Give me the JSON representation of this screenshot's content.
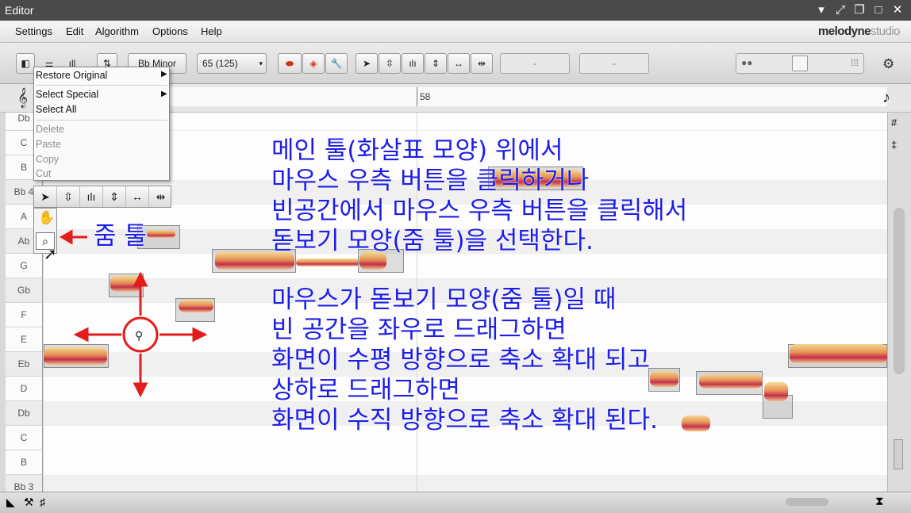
{
  "window": {
    "title": "Editor"
  },
  "menu": {
    "items": [
      "Settings",
      "Edit",
      "Algorithm",
      "Options",
      "Help"
    ],
    "brand": "melodyne",
    "brand_suffix": "studio"
  },
  "toolbar": {
    "scale": "Bb Minor",
    "tempo": "65 (125)",
    "field_a": "-",
    "field_b": "-"
  },
  "ruler": {
    "bar": "58"
  },
  "keys": [
    "Db",
    "C",
    "B",
    "Bb 4",
    "A",
    "Ab",
    "G",
    "Gb",
    "F",
    "E",
    "Eb",
    "D",
    "Db",
    "C",
    "B",
    "Bb 3"
  ],
  "context_menu": {
    "restore_original": "Restore Original",
    "select_special": "Select Special",
    "select_all": "Select All",
    "delete": "Delete",
    "paste": "Paste",
    "copy": "Copy",
    "cut": "Cut"
  },
  "annotation": {
    "zoom_tool_label": "줌 툴",
    "lines_1": [
      "메인 툴(화살표 모양) 위에서",
      "마우스 우측 버튼을 클릭하거나",
      "빈공간에서 마우스 우측 버튼을 클릭해서",
      "돋보기 모양(줌 툴)을 선택한다."
    ],
    "lines_2": [
      "마우스가 돋보기 모양(줌 툴)일 때",
      "빈 공간을 좌우로 드래그하면",
      "화면이 수평 방향으로 축소 확대 되고",
      "상하로 드래그하면",
      "화면이 수직 방향으로 축소 확대 된다."
    ]
  },
  "colors": {
    "annotation": "#1d1de8",
    "arrows": "#e41c1c",
    "accent": "#d3331a"
  }
}
